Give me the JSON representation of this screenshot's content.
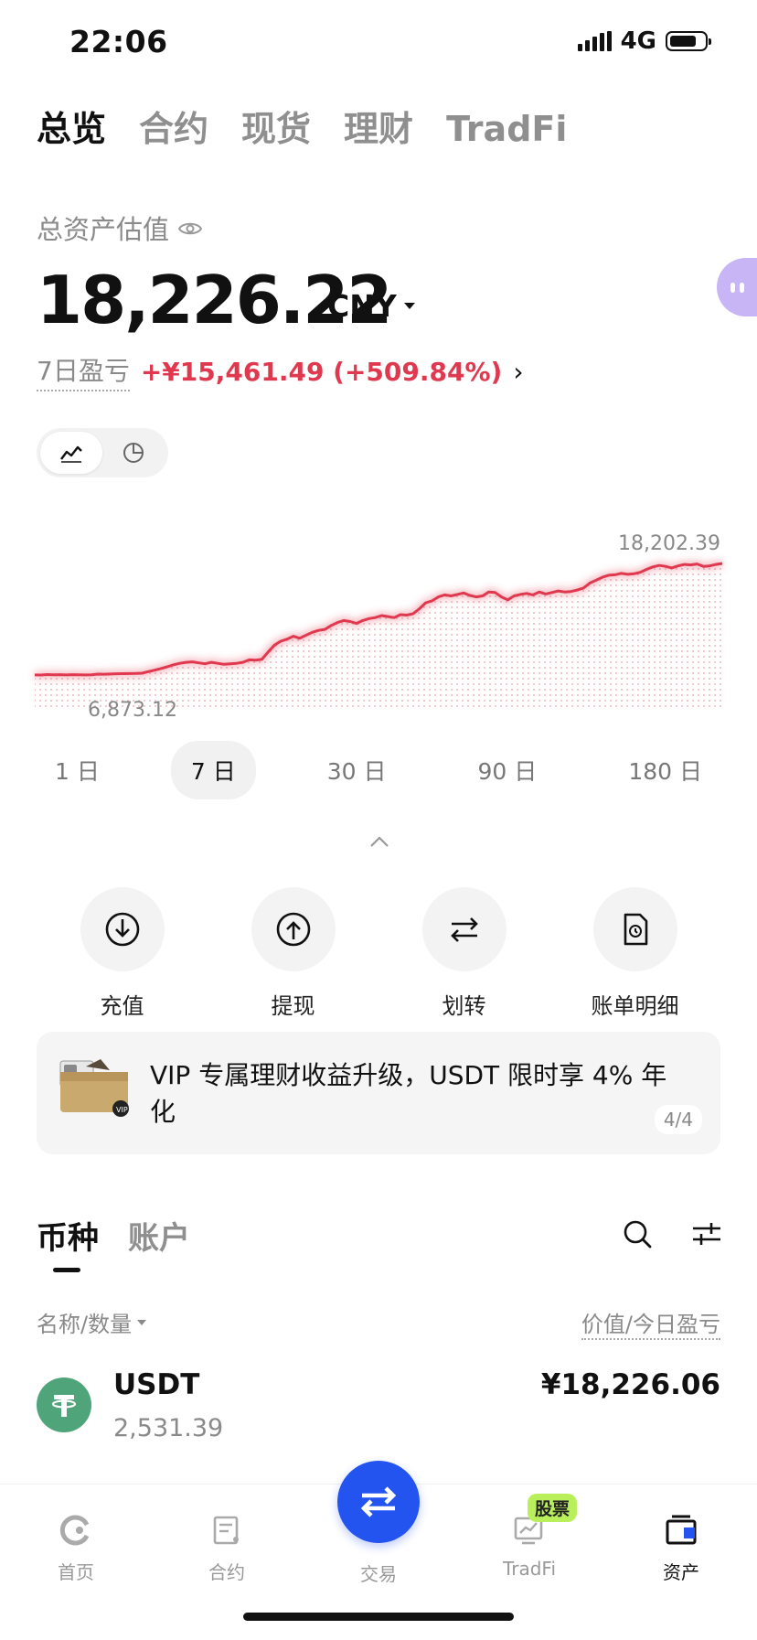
{
  "status_bar": {
    "time": "22:06",
    "network": "4G"
  },
  "top_tabs": [
    {
      "label": "总览",
      "active": true
    },
    {
      "label": "合约",
      "active": false
    },
    {
      "label": "现货",
      "active": false
    },
    {
      "label": "理财",
      "active": false
    },
    {
      "label": "TradFi",
      "active": false
    }
  ],
  "summary": {
    "label": "总资产估值",
    "total": "18,226.22",
    "currency": "CNY",
    "pnl_label": "7日盈亏",
    "pnl_value": "+¥15,461.49 (+509.84%)"
  },
  "chart_data": {
    "type": "area",
    "max_label": "18,202.39",
    "min_label": "6,873.12",
    "color": "#e0384f",
    "values": [
      6873,
      6860,
      6910,
      6880,
      6900,
      6870,
      6895,
      6880,
      6870,
      6890,
      6950,
      6940,
      6960,
      6990,
      7000,
      7010,
      7020,
      7050,
      7200,
      7350,
      7520,
      7700,
      7900,
      8050,
      8150,
      8200,
      8100,
      8000,
      8150,
      8050,
      7950,
      8000,
      8050,
      8150,
      8400,
      8380,
      8450,
      9200,
      9900,
      10300,
      10500,
      10800,
      10600,
      10900,
      11200,
      11400,
      11500,
      11900,
      12200,
      12400,
      12300,
      12100,
      12400,
      12600,
      12700,
      12900,
      12800,
      12700,
      13000,
      12950,
      13100,
      13600,
      14200,
      14400,
      14800,
      15000,
      14900,
      15050,
      15200,
      14950,
      14800,
      14900,
      15300,
      15250,
      14800,
      14500,
      14900,
      15050,
      15150,
      15000,
      15300,
      15100,
      15250,
      15400,
      15300,
      15350,
      15500,
      15700,
      16200,
      16500,
      16800,
      17000,
      17050,
      17200,
      17100,
      17150,
      17300,
      17600,
      17850,
      18000,
      17900,
      17750,
      17950,
      18100,
      18050,
      18150,
      17900,
      17950,
      18100,
      18202
    ]
  },
  "ranges": [
    {
      "label": "1 日",
      "active": false
    },
    {
      "label": "7 日",
      "active": true
    },
    {
      "label": "30 日",
      "active": false
    },
    {
      "label": "90 日",
      "active": false
    },
    {
      "label": "180 日",
      "active": false
    }
  ],
  "actions": [
    {
      "label": "充值",
      "icon": "deposit-icon"
    },
    {
      "label": "提现",
      "icon": "withdraw-icon"
    },
    {
      "label": "划转",
      "icon": "transfer-icon"
    },
    {
      "label": "账单明细",
      "icon": "bill-icon"
    }
  ],
  "banner": {
    "text": "VIP 专属理财收益升级，USDT 限时享 4% 年化",
    "page": "4/4"
  },
  "asset_tabs": [
    {
      "label": "币种",
      "active": true
    },
    {
      "label": "账户",
      "active": false
    }
  ],
  "list_header": {
    "left": "名称/数量",
    "right": "价值/今日盈亏"
  },
  "holdings": [
    {
      "name": "USDT",
      "amount": "2,531.39",
      "value": "¥18,226.06"
    }
  ],
  "bottom_nav": [
    {
      "label": "首页",
      "active": false
    },
    {
      "label": "合约",
      "active": false
    },
    {
      "label": "交易",
      "active": false
    },
    {
      "label": "TradFi",
      "active": false,
      "badge": "股票"
    },
    {
      "label": "资产",
      "active": true
    }
  ]
}
